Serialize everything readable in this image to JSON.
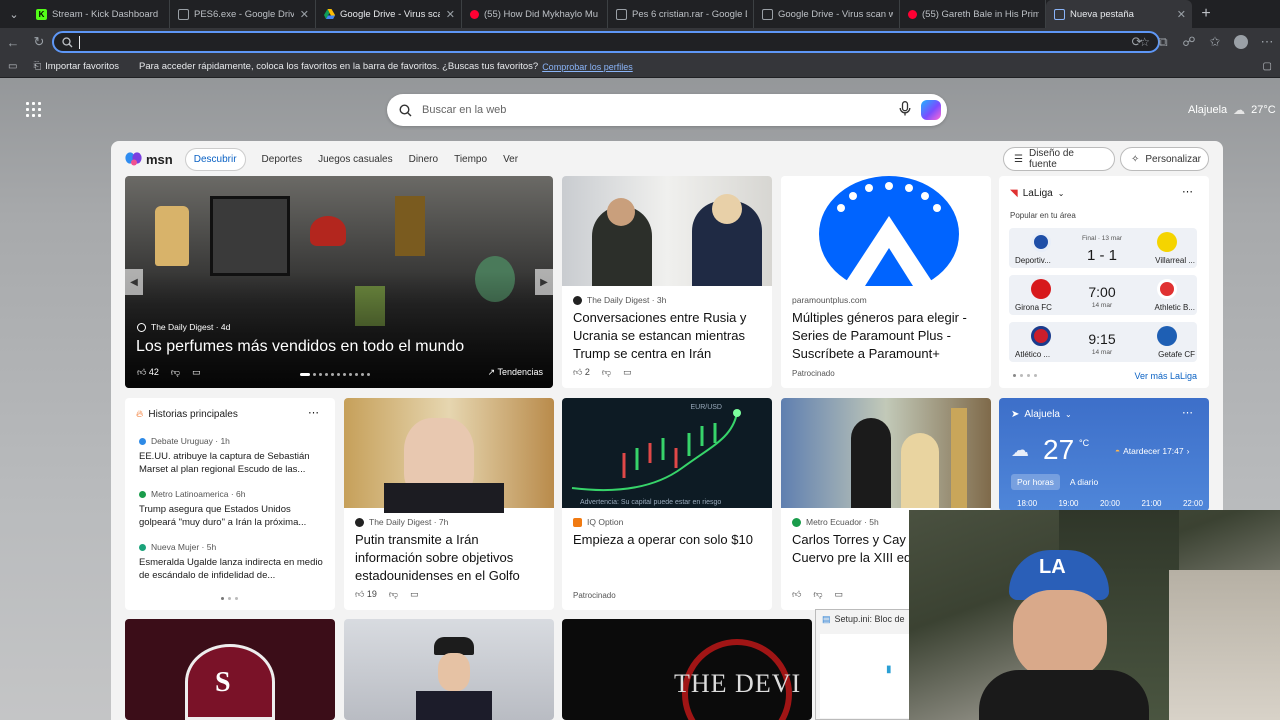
{
  "tabs": [
    {
      "title": "Stream - Kick Dashboard",
      "favicon_color": "#53fc18",
      "favicon_char": "K",
      "active": false
    },
    {
      "title": "PES6.exe - Google Drive",
      "favicon_color": "#1a73e8",
      "favicon_char": "",
      "active": false
    },
    {
      "title": "Google Drive - Virus scan w",
      "favicon_color": "#fbbc04",
      "favicon_char": "",
      "active": false
    },
    {
      "title": "(55) How Did Mykhaylo Mu",
      "favicon_color": "#ff0033",
      "favicon_char": "",
      "active": false
    },
    {
      "title": "Pes 6 cristian.rar - Google D",
      "favicon_color": "#1a73e8",
      "favicon_char": "",
      "active": false
    },
    {
      "title": "Google Drive - Virus scan w",
      "favicon_color": "#1a73e8",
      "favicon_char": "",
      "active": false
    },
    {
      "title": "(55) Gareth Bale in His Prime",
      "favicon_color": "#ff0033",
      "favicon_char": "",
      "active": false
    },
    {
      "title": "Nueva pestaña",
      "favicon_color": "#8ab4f8",
      "favicon_char": "",
      "active": true
    }
  ],
  "omnibox": {
    "value": "",
    "placeholder": ""
  },
  "bookmarks": {
    "import_label": "Importar favoritos",
    "hint": "Para acceder rápidamente, coloca los favoritos en la barra de favoritos. ¿Buscas tus favoritos?",
    "link": "Comprobar los perfiles"
  },
  "search": {
    "placeholder": "Buscar en la web"
  },
  "top_weather": {
    "location": "Alajuela",
    "temp": "27°C"
  },
  "msn": {
    "logo": "msn",
    "nav": [
      "Descubrir",
      "Deportes",
      "Juegos casuales",
      "Dinero",
      "Tiempo",
      "Ver"
    ],
    "font_design": "Diseño de fuente",
    "personalize": "Personalizar"
  },
  "hero": {
    "source": "The Daily Digest · 4d",
    "headline": "Los perfumes más vendidos en todo el mundo",
    "likes": "42",
    "trend": "Tendencias"
  },
  "card2": {
    "source": "The Daily Digest · 3h",
    "headline": "Conversaciones entre Rusia y Ucrania se estancan mientras Trump se centra en Irán",
    "likes": "2"
  },
  "card3": {
    "source": "paramountplus.com",
    "headline": "Múltiples géneros para elegir - Series de Paramount Plus - Suscríbete a Paramount+",
    "sponsored": "Patrocinado"
  },
  "laliga": {
    "title": "LaLiga",
    "subtitle": "Popular en tu área",
    "more": "Ver más LaLiga",
    "matches": [
      {
        "home": "Deportiv...",
        "away": "Villarreal ...",
        "status": "Final · 13 mar",
        "score": "1 - 1",
        "home_color": "#1f4fa8",
        "away_color": "#f5d400"
      },
      {
        "home": "Girona FC",
        "away": "Athletic B...",
        "status": "",
        "score": "7:00",
        "date": "14 mar",
        "home_color": "#d7191c",
        "away_color": "#e03131"
      },
      {
        "home": "Atlético ...",
        "away": "Getafe CF",
        "status": "",
        "score": "9:15",
        "date": "14 mar",
        "home_color": "#cb1e2b",
        "away_color": "#1e5fb4"
      }
    ]
  },
  "top_stories": {
    "title": "Historias principales",
    "items": [
      {
        "source": "Debate Uruguay · 1h",
        "text": "EE.UU. atribuye la captura de Sebastián Marset al plan regional Escudo de las..."
      },
      {
        "source": "Metro Latinoamerica · 6h",
        "text": "Trump asegura que Estados Unidos golpeará \"muy duro\" a Irán la próxima..."
      },
      {
        "source": "Nueva Mujer · 5h",
        "text": "Esmeralda Ugalde lanza indirecta en medio de escándalo de infidelidad de..."
      }
    ]
  },
  "card_putin": {
    "source": "The Daily Digest · 7h",
    "headline": "Putin transmite a Irán información sobre objetivos estadounidenses en el Golfo",
    "likes": "19"
  },
  "card_iq": {
    "overlay_top": "EUR/USD",
    "overlay_bottom": "Advertencia: Su capital puede estar en riesgo",
    "source": "IQ Option",
    "headline": "Empieza a operar con solo $10",
    "sponsored": "Patrocinado"
  },
  "card_carlos": {
    "source": "Metro Ecuador · 5h",
    "headline": "Carlos Torres y Cay Guillén-Cuervo pre la XIII edición de lo"
  },
  "weather_card": {
    "location": "Alajuela",
    "temp": "27",
    "unit": "°C",
    "sunset": "Atardecer 17:47",
    "tabs": [
      "Por horas",
      "A diario"
    ],
    "hours": [
      "18:00",
      "19:00",
      "20:00",
      "21:00",
      "22:00"
    ]
  },
  "bottom_cards": {
    "devil_text": "THE DEVI"
  },
  "notepad": {
    "title": "Setup.ini: Bloc de"
  },
  "colors": {
    "accent": "#0b62c4",
    "chrome_dark": "#202124",
    "chrome_mid": "#35363a",
    "weather_blue": "#3d6fc9"
  }
}
